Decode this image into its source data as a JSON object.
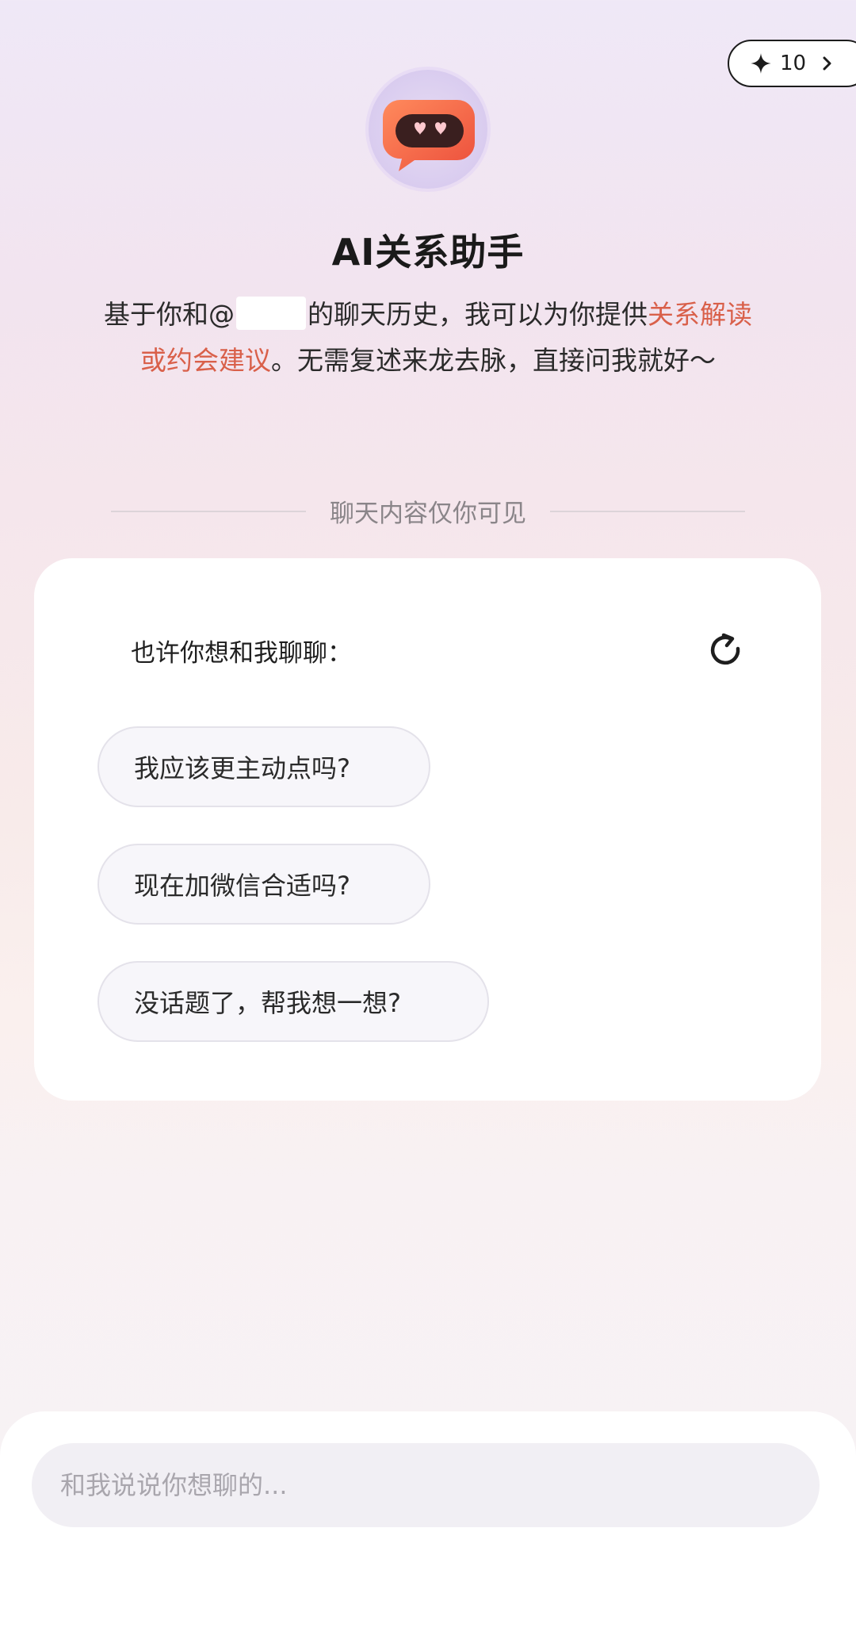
{
  "header": {
    "credits": "10"
  },
  "assistant": {
    "title": "AI关系助手",
    "intro_part1": "基于你和@",
    "intro_part2": "的聊天历史，我可以为你提供",
    "intro_highlight": "关系解读或约会建议",
    "intro_part3": "。无需复述来龙去脉，直接问我就好～"
  },
  "privacy_note": "聊天内容仅你可见",
  "suggestions": {
    "heading": "也许你想和我聊聊：",
    "items": [
      "我应该更主动点吗?",
      "现在加微信合适吗?",
      "没话题了，帮我想一想?"
    ]
  },
  "composer": {
    "placeholder": "和我说说你想聊的..."
  },
  "colors": {
    "accent": "#d9604a",
    "avatar_orange": "#f26a47"
  },
  "icons": {
    "credit": "sparkle-icon",
    "chevron": "chevron-right-icon",
    "refresh": "refresh-icon"
  }
}
